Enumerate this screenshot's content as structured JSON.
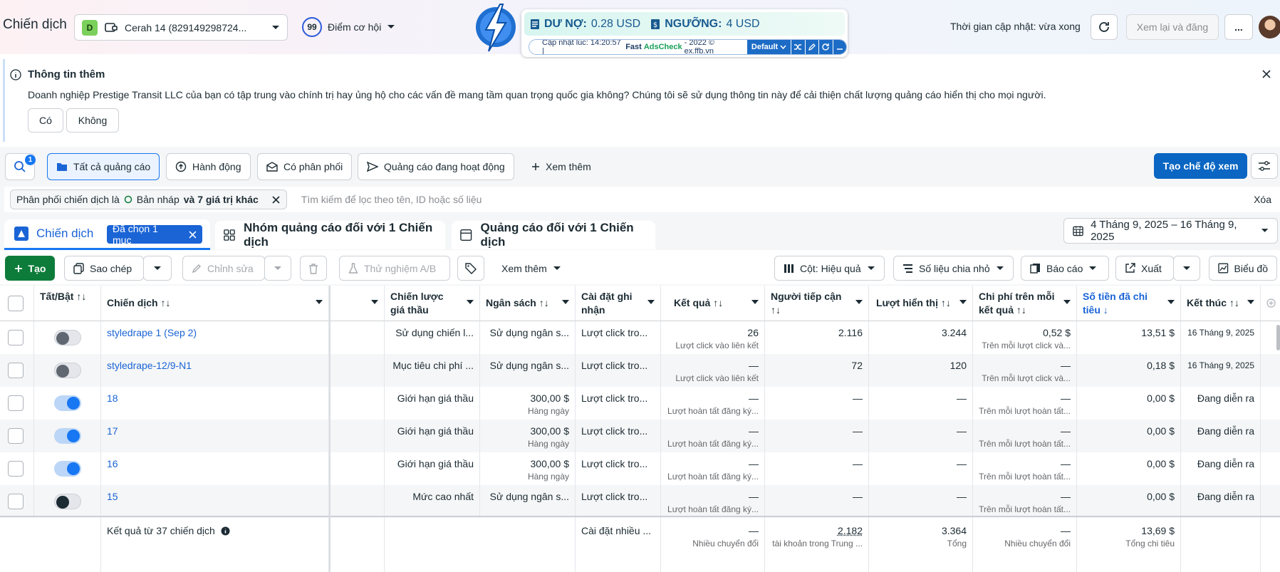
{
  "header": {
    "title": "Chiến dịch",
    "account": {
      "initial": "D",
      "name": "Cerah 14 (829149298724..."
    },
    "opportunity": {
      "score": "99",
      "label": "Điểm cơ hội"
    },
    "update_time": "Thời gian cập nhật: vừa xong",
    "review_label": "Xem lại và đăng",
    "more_label": "..."
  },
  "debt_widget": {
    "debt_label": "DƯ NỢ:",
    "debt_value": "0.28 USD",
    "threshold_label": "NGƯỠNG:",
    "threshold_value": "4 USD",
    "updated": "Cập nhật lúc: 14:20:57 |",
    "brand_fast": "Fast",
    "brand_ads": "AdsCheck",
    "copyright": "- 2022 © ex.ffb.vn",
    "preset": "Default"
  },
  "banner": {
    "title": "Thông tin thêm",
    "text": "Doanh nghiệp Prestige Transit LLC của bạn có tập trung vào chính trị hay ủng hộ cho các vấn đề mang tầm quan trọng quốc gia không? Chúng tôi sẽ sử dụng thông tin này để cải thiện chất lượng quảng cáo hiển thị cho mọi người.",
    "yes": "Có",
    "no": "Không"
  },
  "filters": {
    "badge": "1",
    "all_ads": "Tất cả quảng cáo",
    "actions": "Hành động",
    "delivered": "Có phân phối",
    "active_ads": "Quảng cáo đang hoạt động",
    "see_more": "Xem thêm",
    "create_view": "Tạo chế độ xem",
    "chip_prefix": "Phân phối chiến dịch là",
    "chip_value": "Bản nháp",
    "chip_suffix": "và 7 giá trị khác",
    "search_placeholder": "Tìm kiếm để lọc theo tên, ID hoặc số liệu",
    "clear": "Xóa"
  },
  "tabs": {
    "campaign": "Chiến dịch",
    "selected": "Đã chọn 1 mục",
    "adsets": "Nhóm quảng cáo đối với 1 Chiến dịch",
    "ads": "Quảng cáo đối với 1 Chiến dịch",
    "date_range": "4 Tháng 9, 2025 – 16 Tháng 9, 2025"
  },
  "actions": {
    "create": "Tạo",
    "copy": "Sao chép",
    "edit": "Chỉnh sửa",
    "ab_test": "Thử nghiệm A/B",
    "see_more": "Xem thêm",
    "columns": "Cột: Hiệu quả",
    "breakdown": "Số liệu chia nhỏ",
    "reports": "Báo cáo",
    "export": "Xuất",
    "chart": "Biểu đồ"
  },
  "table": {
    "headers": {
      "toggle": "Tất/Bật ↑↓",
      "name": "Chiến dịch ↑↓",
      "bid": "Chiến lược giá thầu",
      "budget": "Ngân sách ↑↓",
      "attribution": "Cài đặt ghi nhận",
      "results": "Kết quả ↑↓",
      "reach": "Người tiếp cận ↑↓",
      "impressions": "Lượt hiển thị ↑↓",
      "cpr": "Chi phí trên mỗi kết quả ↑↓",
      "spent": "Số tiền đã chi tiêu ↓",
      "end": "Kết thúc ↑↓"
    },
    "rows": [
      {
        "toggle": "off",
        "name": "styledrape 1 (Sep 2)",
        "bid": "Sử dụng chiến l...",
        "budget": "Sử dụng ngân s...",
        "budget_sub": "",
        "attribution": "Lượt click tro...",
        "results": "26",
        "results_sub": "Lượt click vào liên kết",
        "reach": "2.116",
        "impressions": "3.244",
        "cpr": "0,52 $",
        "cpr_sub": "Trên mỗi lượt click và...",
        "spent": "13,51 $",
        "end": "16 Tháng 9, 2025"
      },
      {
        "toggle": "off",
        "name": "styledrape-12/9-N1",
        "bid": "Mục tiêu chi phí ...",
        "budget": "Sử dụng ngân s...",
        "budget_sub": "",
        "attribution": "Lượt click tro...",
        "results": "—",
        "results_sub": "Lượt click vào liên kết",
        "reach": "72",
        "impressions": "120",
        "cpr": "—",
        "cpr_sub": "Trên mỗi lượt click và...",
        "spent": "0,18 $",
        "end": "16 Tháng 9, 2025"
      },
      {
        "toggle": "on",
        "name": "18",
        "bid": "Giới hạn giá thầu",
        "budget": "300,00 $",
        "budget_sub": "Hàng ngày",
        "attribution": "Lượt click tro...",
        "results": "—",
        "results_sub": "Lượt hoàn tất đăng ký...",
        "reach": "—",
        "impressions": "—",
        "cpr": "—",
        "cpr_sub": "Trên mỗi lượt hoàn tất...",
        "spent": "0,00 $",
        "end": "Đang diễn ra"
      },
      {
        "toggle": "on",
        "name": "17",
        "bid": "Giới hạn giá thầu",
        "budget": "300,00 $",
        "budget_sub": "Hàng ngày",
        "attribution": "Lượt click tro...",
        "results": "—",
        "results_sub": "Lượt hoàn tất đăng ký...",
        "reach": "—",
        "impressions": "—",
        "cpr": "—",
        "cpr_sub": "Trên mỗi lượt hoàn tất...",
        "spent": "0,00 $",
        "end": "Đang diễn ra"
      },
      {
        "toggle": "on",
        "name": "16",
        "bid": "Giới hạn giá thầu",
        "budget": "300,00 $",
        "budget_sub": "Hàng ngày",
        "attribution": "Lượt click tro...",
        "results": "—",
        "results_sub": "Lượt hoàn tất đăng ký...",
        "reach": "—",
        "impressions": "—",
        "cpr": "—",
        "cpr_sub": "Trên mỗi lượt hoàn tất...",
        "spent": "0,00 $",
        "end": "Đang diễn ra"
      },
      {
        "toggle": "off-dark",
        "name": "15",
        "bid": "Mức cao nhất",
        "budget": "Sử dụng ngân s...",
        "budget_sub": "",
        "attribution": "Lượt click tro...",
        "results": "—",
        "results_sub": "Lượt hoàn tất đăng ký...",
        "reach": "—",
        "impressions": "—",
        "cpr": "—",
        "cpr_sub": "Trên mỗi lượt hoàn tất...",
        "spent": "0,00 $",
        "end": "Đang diễn ra"
      }
    ],
    "footer": {
      "label": "Kết quả từ 37 chiến dịch",
      "attribution": "Cài đặt nhiều ...",
      "results": "—",
      "results_sub": "Nhiều chuyển đổi",
      "reach": "2.182",
      "reach_sub": "tài khoản trong Trung ...",
      "impressions": "3.364",
      "impressions_sub": "Tổng",
      "cpr": "—",
      "cpr_sub": "Nhiều chuyển đổi",
      "spent": "13,69 $",
      "spent_sub": "Tổng chi tiêu"
    }
  },
  "colors": {
    "primary": "#0a66c2",
    "link": "#1a64d6",
    "create_green": "#0d7c3a"
  }
}
